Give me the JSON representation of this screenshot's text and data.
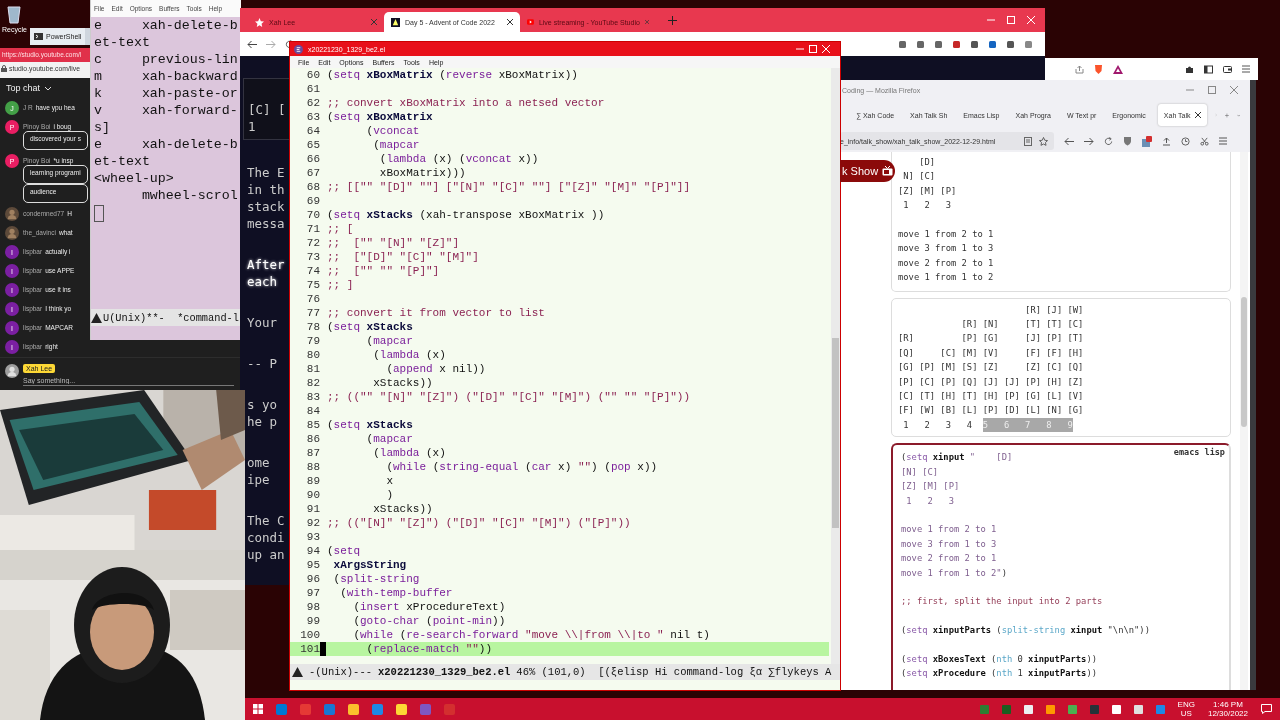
{
  "desktop_icon": {
    "label": "Recycle"
  },
  "powershell_tab": {
    "label": "PowerShell"
  },
  "studio": {
    "url": "https://studio.youtube.com/l",
    "address": "studio.youtube.com/live",
    "chat_title": "Top chat",
    "messages": [
      {
        "kind": "letter",
        "initial": "J",
        "color": "#43a047",
        "author": "J R",
        "lines": [
          "have ypu hea"
        ]
      },
      {
        "kind": "letter",
        "initial": "P",
        "color": "#e91e63",
        "author": "Pinoy Boi",
        "lines": [
          "i boug",
          "discovered your s"
        ]
      },
      {
        "kind": "letter",
        "initial": "P",
        "color": "#e91e63",
        "author": "Pinoy Boi",
        "lines": [
          "*u insp",
          "learning programi",
          "audience"
        ]
      },
      {
        "author": "condemned77",
        "lines": [
          "H"
        ]
      },
      {
        "author": "the_davinci",
        "lines": [
          "what"
        ]
      },
      {
        "kind": "letter",
        "initial": "I",
        "color": "#7b1fa2",
        "author": "lispbar",
        "lines": [
          "actually i"
        ]
      },
      {
        "kind": "letter",
        "initial": "I",
        "color": "#7b1fa2",
        "author": "lispbar",
        "lines": [
          "use APPE"
        ]
      },
      {
        "kind": "letter",
        "initial": "I",
        "color": "#7b1fa2",
        "author": "lispbar",
        "lines": [
          "use it ins"
        ]
      },
      {
        "kind": "letter",
        "initial": "I",
        "color": "#7b1fa2",
        "author": "lispbar",
        "lines": [
          "I think yo"
        ]
      },
      {
        "kind": "letter",
        "initial": "I",
        "color": "#7b1fa2",
        "author": "lispbar",
        "lines": [
          "MAPCAR"
        ]
      },
      {
        "kind": "letter",
        "initial": "I",
        "color": "#7b1fa2",
        "author": "lispbar",
        "lines": [
          "right"
        ]
      }
    ],
    "me": {
      "name": "Xah Lee",
      "placeholder": "Say something..."
    }
  },
  "command_log": {
    "menu": [
      "File",
      "Edit",
      "Options",
      "Buffers",
      "Tools",
      "Help"
    ],
    "lines": [
      "e     xah-delete-b",
      "et-text",
      "c     previous-lin",
      "m     xah-backward",
      "k     xah-paste-or",
      "v     xah-forward-",
      "s]",
      "e     xah-delete-b",
      "et-text",
      "<wheel-up>",
      "      mwheel-scrol"
    ],
    "mode_line": "U(Unix)**-  *command-l"
  },
  "chrome": {
    "tabs": [
      {
        "label": "Xah Lee",
        "selected": false,
        "kind": "star"
      },
      {
        "label": "Day 5 - Advent of Code 2022",
        "selected": true,
        "kind": "aoc"
      },
      {
        "label": "Live streaming - YouTube Studio",
        "selected": false,
        "kind": "youtube"
      }
    ],
    "page": [
      {
        "kind": "box",
        "lines": [
          "[C] [",
          "1"
        ]
      },
      {
        "kind": "para",
        "lines": [
          "The E",
          "in th",
          "stack",
          "messa"
        ]
      },
      {
        "kind": "em",
        "lines": [
          "After",
          "each"
        ]
      },
      {
        "kind": "para",
        "lines": [
          "Your"
        ]
      },
      {
        "kind": "para",
        "lines": [
          "-- P"
        ]
      },
      {
        "kind": "para",
        "lines": [
          "s yo",
          "he p"
        ]
      },
      {
        "kind": "para",
        "lines": [
          "ome",
          "ipe"
        ]
      },
      {
        "kind": "para",
        "lines": [
          "The C",
          "condi",
          "up an"
        ]
      }
    ]
  },
  "firefox": {
    "title": "Coding — Mozilla Firefox",
    "tabs": [
      {
        "label": "∑ Xah Code",
        "selected": false
      },
      {
        "label": "Xah Talk Sh",
        "selected": false
      },
      {
        "label": "Emacs Lisp",
        "selected": false
      },
      {
        "label": "Xah Progra",
        "selected": false
      },
      {
        "label": "W  Text pr",
        "selected": false
      },
      {
        "label": "Ergonomic",
        "selected": false
      },
      {
        "label": "Xah Talk",
        "selected": true
      }
    ],
    "url": "e_info/talk_show/xah_talk_show_2022-12-29.html",
    "banner": "k Show",
    "blocks": [
      {
        "kind": "pre",
        "groups": [
          [
            "    [D]",
            " N] [C]",
            "[Z] [M] [P]",
            " 1   2   3"
          ],
          [
            "move 1 from 2 to 1",
            "move 3 from 1 to 3",
            "move 2 from 2 to 1",
            "move 1 from 1 to 2"
          ]
        ]
      },
      {
        "kind": "crates",
        "lines": [
          "                        [R] [J] [W]",
          "            [R] [N]     [T] [T] [C]",
          "[R]         [P] [G]     [J] [P] [T]",
          "[Q]     [C] [M] [V]     [F] [F] [H]",
          "[G] [P] [M] [S] [Z]     [Z] [C] [Q]",
          "[P] [C] [P] [Q] [J] [J] [P] [H] [Z]",
          "[C] [T] [H] [T] [H] [P] [G] [L] [V]",
          "[F] [W] [B] [L] [P] [D] [L] [N] [G]"
        ],
        "footer": " 1   2   3   4  ",
        "highlight": "5   6   7   8   9"
      },
      {
        "kind": "code",
        "label": "emacs lisp",
        "groups": [
          [
            [
              {
                "kind": "p",
                "text": "("
              },
              {
                "kind": "k",
                "text": "setq"
              },
              {
                "kind": "v",
                "text": " xinput"
              },
              {
                "kind": "s",
                "text": " \"    [D]"
              }
            ],
            [
              {
                "kind": "s",
                "text": "[N] [C]"
              }
            ],
            [
              {
                "kind": "s",
                "text": "[Z] [M] [P]"
              }
            ],
            [
              {
                "kind": "s",
                "text": " 1   2   3"
              }
            ]
          ],
          [
            [
              {
                "kind": "s",
                "text": "move 1 from 2 to 1"
              }
            ],
            [
              {
                "kind": "s",
                "text": "move 3 from 1 to 3"
              }
            ],
            [
              {
                "kind": "s",
                "text": "move 2 from 2 to 1"
              }
            ],
            [
              {
                "kind": "s",
                "text": "move 1 from 1 to 2\""
              },
              {
                "kind": "p",
                "text": ")"
              }
            ]
          ],
          [
            [
              {
                "kind": "c",
                "text": ";; first, split the input into 2 parts"
              }
            ]
          ],
          [
            [
              {
                "kind": "p",
                "text": "("
              },
              {
                "kind": "k",
                "text": "setq"
              },
              {
                "kind": "v",
                "text": " xinputParts"
              },
              {
                "kind": "p",
                "text": " ("
              },
              {
                "kind": "f",
                "text": "split-string"
              },
              {
                "kind": "v",
                "text": " xinput"
              },
              {
                "kind": "p",
                "text": " \"\\n\\n\"))"
              }
            ]
          ],
          [
            [
              {
                "kind": "p",
                "text": "("
              },
              {
                "kind": "k",
                "text": "setq"
              },
              {
                "kind": "v",
                "text": " xBoxesText"
              },
              {
                "kind": "p",
                "text": " ("
              },
              {
                "kind": "f",
                "text": "nth"
              },
              {
                "kind": "p",
                "text": " 0"
              },
              {
                "kind": "v",
                "text": " xinputParts"
              },
              {
                "kind": "p",
                "text": "))"
              }
            ],
            [
              {
                "kind": "p",
                "text": "("
              },
              {
                "kind": "k",
                "text": "setq"
              },
              {
                "kind": "v",
                "text": " xProcedure"
              },
              {
                "kind": "p",
                "text": " ("
              },
              {
                "kind": "f",
                "text": "nth"
              },
              {
                "kind": "p",
                "text": " 1"
              },
              {
                "kind": "v",
                "text": " xinputParts"
              },
              {
                "kind": "p",
                "text": "))"
              }
            ]
          ]
        ]
      }
    ]
  },
  "emacs": {
    "title": "x20221230_1329_be2.el",
    "menu": [
      "File",
      "Edit",
      "Options",
      "Buffers",
      "Tools",
      "Help"
    ],
    "lines": [
      {
        "n": "60",
        "current": false,
        "segs": [
          {
            "kind": "p",
            "text": "("
          },
          {
            "kind": "k",
            "text": "setq"
          },
          {
            "kind": "v",
            "text": " xBoxMatrix"
          },
          {
            "kind": "p",
            "text": " ("
          },
          {
            "kind": "k",
            "text": "reverse"
          },
          {
            "kind": "p",
            "text": " xBoxMatrix))"
          }
        ]
      },
      {
        "n": "61",
        "current": false
      },
      {
        "n": "62",
        "current": false,
        "segs": [
          {
            "kind": "c",
            "text": ";; convert xBoxMatrix into a netsed vector"
          }
        ]
      },
      {
        "n": "63",
        "current": false,
        "segs": [
          {
            "kind": "p",
            "text": "("
          },
          {
            "kind": "k",
            "text": "setq"
          },
          {
            "kind": "v",
            "text": " xBoxMatrix"
          }
        ]
      },
      {
        "n": "64",
        "current": false,
        "segs": [
          {
            "kind": "p",
            "text": "      ("
          },
          {
            "kind": "k",
            "text": "vconcat"
          }
        ]
      },
      {
        "n": "65",
        "current": false,
        "segs": [
          {
            "kind": "p",
            "text": "       ("
          },
          {
            "kind": "k",
            "text": "mapcar"
          }
        ]
      },
      {
        "n": "66",
        "current": false,
        "segs": [
          {
            "kind": "p",
            "text": "        ("
          },
          {
            "kind": "k",
            "text": "lambda"
          },
          {
            "kind": "p",
            "text": " (x) ("
          },
          {
            "kind": "k",
            "text": "vconcat"
          },
          {
            "kind": "p",
            "text": " x))"
          }
        ]
      },
      {
        "n": "67",
        "current": false,
        "segs": [
          {
            "kind": "p",
            "text": "        xBoxMatrix)))"
          }
        ]
      },
      {
        "n": "68",
        "current": false,
        "segs": [
          {
            "kind": "c",
            "text": ";; [[\"\" \"[D]\" \"\"] [\"[N]\" \"[C]\" \"\"] [\"[Z]\" \"[M]\" \"[P]\"]]"
          }
        ]
      },
      {
        "n": "69",
        "current": false
      },
      {
        "n": "70",
        "current": false,
        "segs": [
          {
            "kind": "p",
            "text": "("
          },
          {
            "kind": "k",
            "text": "setq"
          },
          {
            "kind": "v",
            "text": " xStacks"
          },
          {
            "kind": "p",
            "text": " (xah-transpose xBoxMatrix ))"
          }
        ]
      },
      {
        "n": "71",
        "current": false,
        "segs": [
          {
            "kind": "c",
            "text": ";; ["
          }
        ]
      },
      {
        "n": "72",
        "current": false,
        "segs": [
          {
            "kind": "c",
            "text": ";;  [\"\" \"[N]\" \"[Z]\"]"
          }
        ]
      },
      {
        "n": "73",
        "current": false,
        "segs": [
          {
            "kind": "c",
            "text": ";;  [\"[D]\" \"[C]\" \"[M]\"]"
          }
        ]
      },
      {
        "n": "74",
        "current": false,
        "segs": [
          {
            "kind": "c",
            "text": ";;  [\"\" \"\" \"[P]\"]"
          }
        ]
      },
      {
        "n": "75",
        "current": false,
        "segs": [
          {
            "kind": "c",
            "text": ";; ]"
          }
        ]
      },
      {
        "n": "76",
        "current": false
      },
      {
        "n": "77",
        "current": false,
        "segs": [
          {
            "kind": "c",
            "text": ";; convert it from vector to list"
          }
        ]
      },
      {
        "n": "78",
        "current": false,
        "segs": [
          {
            "kind": "p",
            "text": "("
          },
          {
            "kind": "k",
            "text": "setq"
          },
          {
            "kind": "v",
            "text": " xStacks"
          }
        ]
      },
      {
        "n": "79",
        "current": false,
        "segs": [
          {
            "kind": "p",
            "text": "      ("
          },
          {
            "kind": "k",
            "text": "mapcar"
          }
        ]
      },
      {
        "n": "80",
        "current": false,
        "segs": [
          {
            "kind": "p",
            "text": "       ("
          },
          {
            "kind": "k",
            "text": "lambda"
          },
          {
            "kind": "p",
            "text": " (x)"
          }
        ]
      },
      {
        "n": "81",
        "current": false,
        "segs": [
          {
            "kind": "p",
            "text": "         ("
          },
          {
            "kind": "k",
            "text": "append"
          },
          {
            "kind": "p",
            "text": " x nil))"
          }
        ]
      },
      {
        "n": "82",
        "current": false,
        "segs": [
          {
            "kind": "p",
            "text": "       xStacks))"
          }
        ]
      },
      {
        "n": "83",
        "current": false,
        "segs": [
          {
            "kind": "c",
            "text": ";; ((\"\" \"[N]\" \"[Z]\") (\"[D]\" \"[C]\" \"[M]\") (\"\" \"\" \"[P]\"))"
          }
        ]
      },
      {
        "n": "84",
        "current": false
      },
      {
        "n": "85",
        "current": false,
        "segs": [
          {
            "kind": "p",
            "text": "("
          },
          {
            "kind": "k",
            "text": "setq"
          },
          {
            "kind": "v",
            "text": " xStacks"
          }
        ]
      },
      {
        "n": "86",
        "current": false,
        "segs": [
          {
            "kind": "p",
            "text": "      ("
          },
          {
            "kind": "k",
            "text": "mapcar"
          }
        ]
      },
      {
        "n": "87",
        "current": false,
        "segs": [
          {
            "kind": "p",
            "text": "       ("
          },
          {
            "kind": "k",
            "text": "lambda"
          },
          {
            "kind": "p",
            "text": " (x)"
          }
        ]
      },
      {
        "n": "88",
        "current": false,
        "segs": [
          {
            "kind": "p",
            "text": "         ("
          },
          {
            "kind": "k",
            "text": "while"
          },
          {
            "kind": "p",
            "text": " ("
          },
          {
            "kind": "k",
            "text": "string-equal"
          },
          {
            "kind": "p",
            "text": " ("
          },
          {
            "kind": "k",
            "text": "car"
          },
          {
            "kind": "p",
            "text": " x) "
          },
          {
            "kind": "s",
            "text": "\"\""
          },
          {
            "kind": "p",
            "text": ") ("
          },
          {
            "kind": "k",
            "text": "pop"
          },
          {
            "kind": "p",
            "text": " x))"
          }
        ]
      },
      {
        "n": "89",
        "current": false,
        "segs": [
          {
            "kind": "p",
            "text": "         x"
          }
        ]
      },
      {
        "n": "90",
        "current": false,
        "segs": [
          {
            "kind": "p",
            "text": "         )"
          }
        ]
      },
      {
        "n": "91",
        "current": false,
        "segs": [
          {
            "kind": "p",
            "text": "       xStacks))"
          }
        ]
      },
      {
        "n": "92",
        "current": false,
        "segs": [
          {
            "kind": "c",
            "text": ";; ((\"[N]\" \"[Z]\") (\"[D]\" \"[C]\" \"[M]\") (\"[P]\"))"
          }
        ]
      },
      {
        "n": "93",
        "current": false
      },
      {
        "n": "94",
        "current": false,
        "segs": [
          {
            "kind": "p",
            "text": "("
          },
          {
            "kind": "k",
            "text": "setq"
          }
        ]
      },
      {
        "n": "95",
        "current": false,
        "segs": [
          {
            "kind": "v",
            "text": " xArgsString"
          }
        ]
      },
      {
        "n": "96",
        "current": false,
        "segs": [
          {
            "kind": "p",
            "text": " ("
          },
          {
            "kind": "k",
            "text": "split-string"
          }
        ]
      },
      {
        "n": "97",
        "current": false,
        "segs": [
          {
            "kind": "p",
            "text": "  ("
          },
          {
            "kind": "k",
            "text": "with-temp-buffer"
          }
        ]
      },
      {
        "n": "98",
        "current": false,
        "segs": [
          {
            "kind": "p",
            "text": "    ("
          },
          {
            "kind": "k",
            "text": "insert"
          },
          {
            "kind": "p",
            "text": " xProcedureText)"
          }
        ]
      },
      {
        "n": "99",
        "current": false,
        "segs": [
          {
            "kind": "p",
            "text": "    ("
          },
          {
            "kind": "k",
            "text": "goto-char"
          },
          {
            "kind": "p",
            "text": " ("
          },
          {
            "kind": "k",
            "text": "point-min"
          },
          {
            "kind": "p",
            "text": "))"
          }
        ]
      },
      {
        "n": "100",
        "current": false,
        "segs": [
          {
            "kind": "p",
            "text": "    ("
          },
          {
            "kind": "k",
            "text": "while"
          },
          {
            "kind": "p",
            "text": " ("
          },
          {
            "kind": "k",
            "text": "re-search-forward"
          },
          {
            "kind": "s",
            "text": " \"move \\\\|from \\\\|to \""
          },
          {
            "kind": "p",
            "text": " nil t)"
          }
        ]
      },
      {
        "n": "101",
        "current": true,
        "segs": [
          {
            "kind": "p",
            "text": "      ("
          },
          {
            "kind": "k",
            "text": "replace-match"
          },
          {
            "kind": "s",
            "text": " \"\""
          },
          {
            "kind": "p",
            "text": "))"
          }
        ]
      }
    ],
    "mode_left": "-(Unix)---",
    "mode_file": "x20221230_1329_be2.el",
    "mode_right": "46% (101,0)  [(ξelisp Hi command-log ξα ∑flykeys A"
  },
  "taskbar": {
    "lang": "ENG",
    "region": "US",
    "time": "1:46 PM",
    "date": "12/30/2022"
  }
}
